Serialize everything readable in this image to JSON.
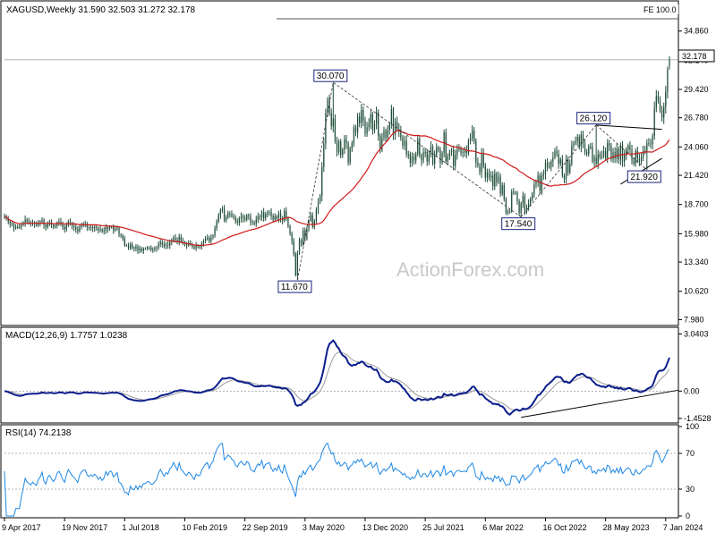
{
  "colors": {
    "candle": "#1f4e3a",
    "ma": "#d01818",
    "macd": "#0b1e8c",
    "signal": "#9a9a9a",
    "rsi": "#1e88e5",
    "frame": "#000000",
    "guide": "#9a9a9a",
    "label_box": "#1a237e"
  },
  "watermark": "ActionForex.com",
  "chart_data": [
    {
      "type": "candlestick",
      "header": "XAGUSD,Weekly  31.590 32.503 31.272 32.178",
      "symbol": "XAGUSD",
      "timeframe": "Weekly",
      "ohlc_last": {
        "open": 31.59,
        "high": 32.503,
        "low": 31.272,
        "close": 32.178
      },
      "current_price_label": "32.178",
      "fe_label": "FE 100.0",
      "fe_level": 36.0,
      "y_ticks": [
        "34.860",
        "32.140",
        "29.420",
        "26.780",
        "24.060",
        "21.420",
        "18.700",
        "15.980",
        "13.340",
        "10.620",
        "7.980"
      ],
      "y_tick_values": [
        34.86,
        32.14,
        29.42,
        26.78,
        24.06,
        21.42,
        18.7,
        15.98,
        13.34,
        10.62,
        7.98
      ],
      "ylim": [
        7.6,
        37.5
      ],
      "pivots": [
        {
          "label": "11.670",
          "index": 156,
          "value": 11.67
        },
        {
          "label": "30.070",
          "index": 175,
          "value": 30.07
        },
        {
          "label": "17.540",
          "index": 275,
          "value": 17.54
        },
        {
          "label": "26.120",
          "index": 315,
          "value": 26.12
        },
        {
          "label": "21.920",
          "index": 342,
          "value": 21.92
        }
      ],
      "ma_label": "moving average",
      "closes": [
        17.6,
        17.4,
        17.1,
        16.9,
        16.9,
        16.5,
        16.6,
        16.6,
        16.6,
        16.8,
        17.0,
        17.3,
        17.1,
        17.0,
        16.9,
        17.0,
        16.9,
        16.8,
        17.0,
        17.1,
        17.3,
        16.8,
        16.6,
        16.9,
        17.0,
        16.8,
        16.6,
        16.7,
        17.0,
        17.1,
        16.9,
        16.6,
        16.4,
        16.8,
        17.1,
        16.9,
        16.7,
        16.6,
        16.4,
        16.2,
        16.6,
        16.8,
        16.9,
        16.9,
        16.6,
        16.5,
        16.6,
        16.5,
        16.6,
        16.5,
        16.3,
        16.4,
        16.2,
        16.3,
        16.6,
        16.4,
        16.6,
        16.6,
        16.3,
        16.4,
        16.5,
        15.9,
        15.8,
        15.5,
        14.9,
        14.9,
        14.6,
        15.0,
        14.7,
        14.6,
        14.8,
        14.4,
        14.6,
        14.4,
        14.6,
        14.6,
        14.7,
        14.7,
        14.5,
        14.5,
        14.6,
        14.7,
        15.0,
        15.2,
        15.0,
        14.8,
        15.0,
        14.9,
        15.2,
        15.3,
        15.6,
        15.4,
        15.2,
        15.7,
        15.3,
        15.2,
        15.0,
        14.9,
        15.1,
        15.0,
        14.8,
        14.6,
        14.9,
        14.8,
        14.8,
        15.1,
        15.3,
        15.5,
        15.6,
        15.3,
        15.6,
        15.8,
        16.5,
        17.1,
        17.7,
        18.2,
        18.3,
        17.2,
        17.5,
        17.9,
        17.8,
        17.6,
        17.5,
        17.1,
        17.0,
        17.4,
        17.6,
        17.4,
        17.3,
        17.7,
        17.6,
        17.1,
        17.0,
        16.9,
        17.3,
        17.6,
        17.5,
        18.0,
        17.4,
        17.8,
        17.9,
        18.0,
        17.6,
        17.3,
        17.6,
        17.4,
        17.9,
        17.4,
        17.2,
        18.1,
        17.4,
        16.7,
        16.0,
        15.3,
        14.1,
        12.1,
        14.2,
        15.4,
        15.0,
        16.3,
        15.5,
        16.4,
        17.2,
        17.7,
        16.6,
        17.2,
        18.2,
        18.9,
        19.5,
        22.2,
        24.4,
        27.2,
        28.5,
        27.2,
        26.0,
        26.7,
        24.6,
        23.6,
        24.6,
        23.3,
        23.8,
        24.8,
        24.4,
        22.6,
        23.9,
        24.4,
        25.9,
        25.4,
        26.9,
        26.3,
        27.5,
        26.5,
        25.3,
        25.9,
        26.3,
        27.1,
        25.6,
        26.2,
        27.3,
        25.1,
        23.8,
        24.9,
        25.6,
        24.9,
        25.6,
        26.2,
        27.6,
        25.2,
        26.4,
        25.7,
        25.5,
        24.9,
        24.2,
        24.6,
        23.4,
        23.4,
        22.6,
        23.2,
        22.8,
        23.4,
        24.8,
        23.3,
        22.8,
        23.6,
        23.6,
        22.7,
        23.3,
        24.1,
        22.5,
        23.3,
        24.0,
        23.8,
        22.6,
        23.5,
        25.4,
        22.7,
        23.2,
        23.6,
        23.8,
        22.3,
        23.3,
        23.8,
        23.9,
        23.5,
        23.6,
        23.7,
        23.5,
        24.6,
        24.9,
        25.6,
        24.6,
        22.6,
        22.3,
        21.7,
        23.5,
        22.3,
        21.2,
        21.7,
        21.2,
        21.4,
        20.4,
        21.6,
        20.8,
        21.3,
        19.7,
        20.5,
        19.2,
        17.9,
        18.1,
        18.1,
        19.9,
        19.8,
        19.8,
        19.0,
        17.9,
        18.8,
        19.5,
        18.0,
        18.4,
        18.8,
        19.2,
        19.7,
        20.6,
        20.8,
        21.4,
        20.0,
        21.4,
        21.5,
        22.6,
        22.2,
        22.2,
        22.7,
        23.1,
        23.7,
        23.4,
        22.5,
        22.9,
        21.4,
        21.1,
        22.9,
        21.7,
        22.5,
        24.2,
        24.4,
        24.6,
        25.0,
        24.1,
        25.2,
        24.3,
        23.6,
        23.4,
        24.1,
        24.1,
        22.7,
        23.1,
        22.5,
        23.4,
        23.1,
        23.2,
        23.7,
        23.0,
        24.4,
        24.2,
        22.9,
        23.6,
        23.0,
        23.9,
        22.9,
        24.2,
        22.7,
        23.3,
        23.8,
        24.2,
        23.8,
        22.8,
        22.5,
        23.7,
        23.0,
        22.7,
        23.1,
        23.7,
        23.7,
        24.4,
        24.4,
        24.3,
        25.1,
        27.7,
        28.8,
        28.4,
        27.5,
        26.8,
        27.8,
        29.2,
        31.3,
        32.178
      ]
    },
    {
      "type": "line",
      "header": "MACD(12,26,9) 1.7757 1.0238",
      "params": "12,26,9",
      "values_label": [
        "1.7757",
        "1.0238"
      ],
      "macd_last": 1.7757,
      "signal_last": 1.0238,
      "y_ticks": [
        "3.0403",
        "0.00",
        "-1.4528"
      ],
      "y_tick_values": [
        3.0403,
        0.0,
        -1.4528
      ]
    },
    {
      "type": "line",
      "header": "RSI(14) 74.2138",
      "period": 14,
      "rsi_last": 74.2138,
      "y_ticks": [
        "100",
        "70",
        "30",
        "0"
      ],
      "y_tick_values": [
        100,
        70,
        30,
        0
      ]
    }
  ],
  "x_axis": {
    "labels": [
      "9 Apr 2017",
      "19 Nov 2017",
      "1 Jul 2018",
      "10 Feb 2019",
      "22 Sep 2019",
      "3 May 2020",
      "13 Dec 2020",
      "25 Jul 2021",
      "6 Mar 2022",
      "16 Oct 2022",
      "28 May 2023",
      "7 Jan 2024"
    ],
    "label_indices": [
      0,
      32,
      64,
      96,
      128,
      160,
      192,
      224,
      256,
      288,
      320,
      352
    ]
  }
}
